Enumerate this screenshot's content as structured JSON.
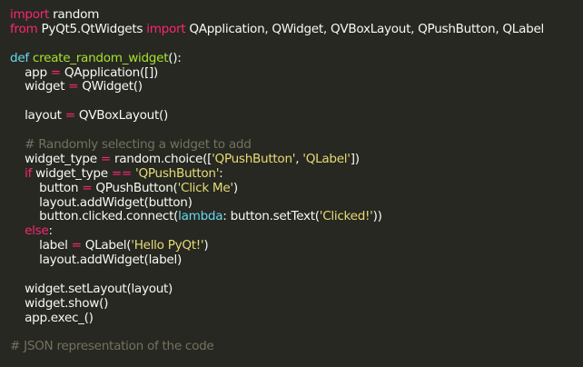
{
  "editor": {
    "lines": [
      [
        {
          "t": "kw",
          "v": "import"
        },
        {
          "t": "plain",
          "v": " random"
        }
      ],
      [
        {
          "t": "kw",
          "v": "from"
        },
        {
          "t": "plain",
          "v": " PyQt5.QtWidgets "
        },
        {
          "t": "kw",
          "v": "import"
        },
        {
          "t": "plain",
          "v": " QApplication, QWidget, QVBoxLayout, QPushButton, QLabel"
        }
      ],
      [],
      [
        {
          "t": "def",
          "v": "def"
        },
        {
          "t": "plain",
          "v": " "
        },
        {
          "t": "fn",
          "v": "create_random_widget"
        },
        {
          "t": "plain",
          "v": "():"
        }
      ],
      [
        {
          "t": "plain",
          "v": "    app "
        },
        {
          "t": "op",
          "v": "="
        },
        {
          "t": "plain",
          "v": " QApplication([])"
        }
      ],
      [
        {
          "t": "plain",
          "v": "    widget "
        },
        {
          "t": "op",
          "v": "="
        },
        {
          "t": "plain",
          "v": " QWidget()"
        }
      ],
      [],
      [
        {
          "t": "plain",
          "v": "    layout "
        },
        {
          "t": "op",
          "v": "="
        },
        {
          "t": "plain",
          "v": " QVBoxLayout()"
        }
      ],
      [],
      [
        {
          "t": "cm",
          "v": "    # Randomly selecting a widget to add"
        }
      ],
      [
        {
          "t": "plain",
          "v": "    widget_type "
        },
        {
          "t": "op",
          "v": "="
        },
        {
          "t": "plain",
          "v": " random.choice(["
        },
        {
          "t": "str",
          "v": "'QPushButton'"
        },
        {
          "t": "plain",
          "v": ", "
        },
        {
          "t": "str",
          "v": "'QLabel'"
        },
        {
          "t": "plain",
          "v": "])"
        }
      ],
      [
        {
          "t": "plain",
          "v": "    "
        },
        {
          "t": "kw",
          "v": "if"
        },
        {
          "t": "plain",
          "v": " widget_type "
        },
        {
          "t": "op",
          "v": "=="
        },
        {
          "t": "plain",
          "v": " "
        },
        {
          "t": "str",
          "v": "'QPushButton'"
        },
        {
          "t": "plain",
          "v": ":"
        }
      ],
      [
        {
          "t": "plain",
          "v": "        button "
        },
        {
          "t": "op",
          "v": "="
        },
        {
          "t": "plain",
          "v": " QPushButton("
        },
        {
          "t": "str",
          "v": "'Click Me'"
        },
        {
          "t": "plain",
          "v": ")"
        }
      ],
      [
        {
          "t": "plain",
          "v": "        layout.addWidget(button)"
        }
      ],
      [
        {
          "t": "plain",
          "v": "        button.clicked.connect("
        },
        {
          "t": "def",
          "v": "lambda"
        },
        {
          "t": "plain",
          "v": ": button.setText("
        },
        {
          "t": "str",
          "v": "'Clicked!'"
        },
        {
          "t": "plain",
          "v": "))"
        }
      ],
      [
        {
          "t": "plain",
          "v": "    "
        },
        {
          "t": "kw",
          "v": "else"
        },
        {
          "t": "plain",
          "v": ":"
        }
      ],
      [
        {
          "t": "plain",
          "v": "        label "
        },
        {
          "t": "op",
          "v": "="
        },
        {
          "t": "plain",
          "v": " QLabel("
        },
        {
          "t": "str",
          "v": "'Hello PyQt!'"
        },
        {
          "t": "plain",
          "v": ")"
        }
      ],
      [
        {
          "t": "plain",
          "v": "        layout.addWidget(label)"
        }
      ],
      [],
      [
        {
          "t": "plain",
          "v": "    widget.setLayout(layout)"
        }
      ],
      [
        {
          "t": "plain",
          "v": "    widget.show()"
        }
      ],
      [
        {
          "t": "plain",
          "v": "    app.exec_()"
        }
      ],
      [],
      [
        {
          "t": "cm",
          "v": "# JSON representation of the code"
        }
      ]
    ]
  },
  "colors": {
    "background": "#272822",
    "keyword": "#f92672",
    "builtin": "#66d9ef",
    "function": "#a6e22e",
    "string": "#e6db74",
    "comment": "#75715e",
    "text": "#f8f8f2"
  }
}
